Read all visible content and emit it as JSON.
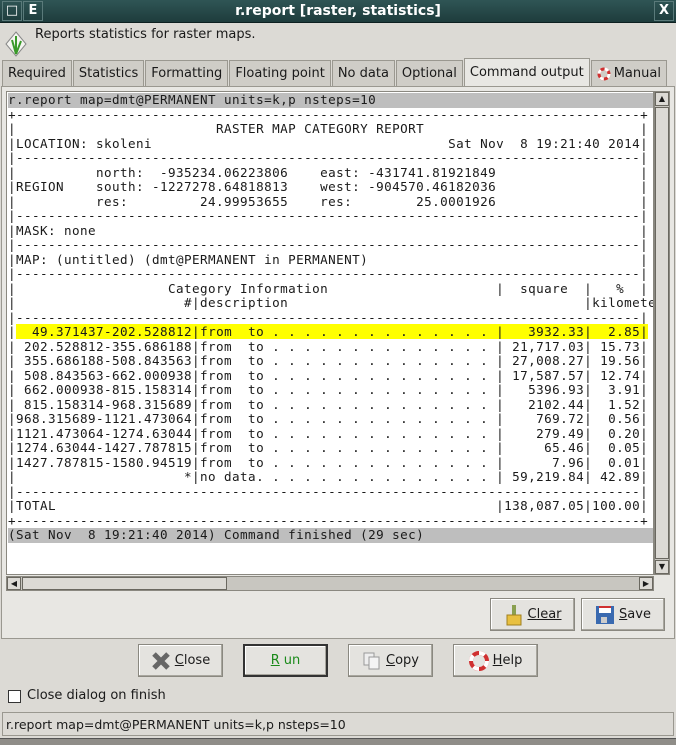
{
  "window": {
    "title": "r.report [raster, statistics]",
    "menu_btn": "E",
    "close_btn": "X"
  },
  "description": "Reports statistics for raster maps.",
  "tabs": [
    {
      "label": "Required"
    },
    {
      "label": "Statistics"
    },
    {
      "label": "Formatting"
    },
    {
      "label": "Floating point"
    },
    {
      "label": "No data"
    },
    {
      "label": "Optional"
    },
    {
      "label": "Command output",
      "active": true
    },
    {
      "label": "Manual",
      "icon": "lifebuoy-icon"
    }
  ],
  "output": {
    "command": "r.report map=dmt@PERMANENT units=k,p nsteps=10",
    "report_title": "RASTER MAP CATEGORY REPORT",
    "location": "LOCATION: skoleni",
    "date": "Sat Nov  8 19:21:40 2014",
    "region": [
      "          north:  -935234.06223806    east: -431741.81921849",
      "REGION    south: -1227278.64818813    west: -904570.46182036",
      "          res:         24.99953655    res:        25.0001926"
    ],
    "mask": "MASK: none",
    "map": "MAP: (untitled) (dmt@PERMANENT in PERMANENT)",
    "columns": {
      "category": "Category Information",
      "number": "#",
      "description": "description",
      "area": "square",
      "area_unit": "kilometers",
      "percent": "%"
    },
    "rows": [
      {
        "category": "49.371437-202.528812",
        "description": "from  to",
        "area": "3932.33",
        "percent": "2.85",
        "highlighted": true
      },
      {
        "category": "202.528812-355.686188",
        "description": "from  to",
        "area": "21,717.03",
        "percent": "15.73"
      },
      {
        "category": "355.686188-508.843563",
        "description": "from  to",
        "area": "27,008.27",
        "percent": "19.56"
      },
      {
        "category": "508.843563-662.000938",
        "description": "from  to",
        "area": "17,587.57",
        "percent": "12.74"
      },
      {
        "category": "662.000938-815.158314",
        "description": "from  to",
        "area": "5396.93",
        "percent": "3.91"
      },
      {
        "category": "815.158314-968.315689",
        "description": "from  to",
        "area": "2102.44",
        "percent": "1.52"
      },
      {
        "category": "968.315689-1121.473064",
        "description": "from  to",
        "area": "769.72",
        "percent": "0.56"
      },
      {
        "category": "1121.473064-1274.63044",
        "description": "from  to",
        "area": "279.49",
        "percent": "0.20"
      },
      {
        "category": "1274.63044-1427.787815",
        "description": "from  to",
        "area": "65.46",
        "percent": "0.05"
      },
      {
        "category": "1427.787815-1580.94519",
        "description": "from  to",
        "area": "7.96",
        "percent": "0.01"
      },
      {
        "category": "*",
        "description": "no data.",
        "area": "59,219.84",
        "percent": "42.89"
      }
    ],
    "total": {
      "label": "TOTAL",
      "area": "138,087.05",
      "percent": "100.00"
    },
    "finished": "(Sat Nov  8 19:21:40 2014) Command finished (29 sec)",
    "highlight_color": "#ffff00"
  },
  "buttons": {
    "clear": "Clear",
    "save": "Save",
    "close": "Close",
    "run": "Run",
    "copy": "Copy",
    "help": "Help"
  },
  "close_on_finish": {
    "label": "Close dialog on finish",
    "checked": false
  },
  "statusbar": "r.report map=dmt@PERMANENT units=k,p nsteps=10"
}
